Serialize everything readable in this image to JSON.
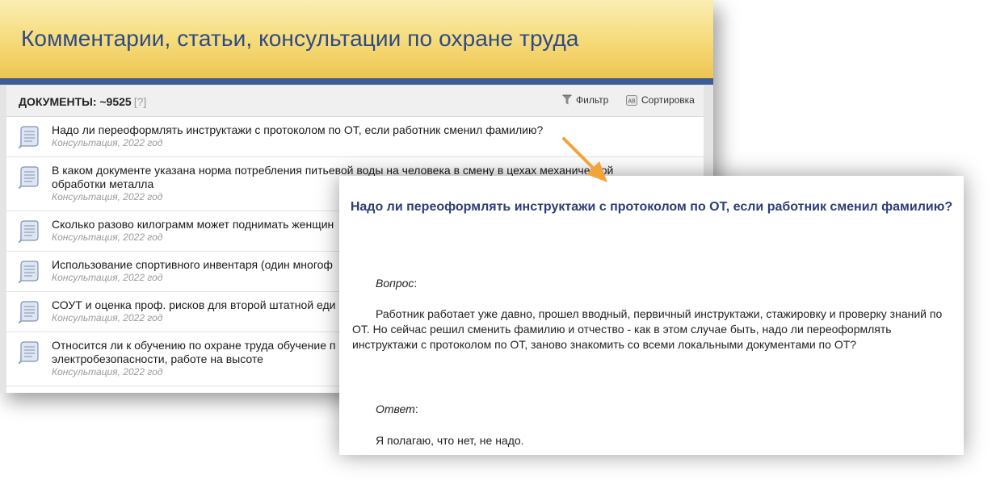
{
  "banner": {
    "title": "Комментарии, статьи, консультации по охране труда"
  },
  "documents": {
    "count_label": "ДОКУМЕНТЫ: ~9525",
    "help_label": "[?]",
    "filter_label": "Фильтр",
    "sort_label": "Сортировка",
    "items": [
      {
        "title": "Надо ли переоформлять инструктажи с протоколом по ОТ, если работник сменил фамилию?",
        "meta": "Консультация, 2022 год"
      },
      {
        "title": "В каком документе указана норма потребления питьевой воды на человека в смену в цехах механической обработки металла",
        "meta": "Консультация, 2022 год"
      },
      {
        "title": "Сколько разово килограмм может поднимать женщин",
        "meta": "Консультация, 2022 год"
      },
      {
        "title": "Использование спортивного инвентаря (один многоф",
        "meta": "Консультация, 2022 год"
      },
      {
        "title": "СОУТ и оценка проф. рисков для второй штатной еди",
        "meta": "Консультация, 2022 год"
      },
      {
        "title": "Относится ли к обучению по охране труда обучение п электробезопасности, работе на высоте",
        "meta": "Консультация, 2022 год"
      }
    ]
  },
  "document_view": {
    "title": "Надо ли переоформлять инструктажи с протоколом по ОТ, если работник сменил фамилию?",
    "question_label": "Вопрос",
    "question_text": "Работник работает уже давно, прошел вводный, первичный инструктажи, стажировку и проверку знаний по ОТ. Но сейчас решил сменить фамилию и отчество - как в этом случае быть, надо ли переоформлять инструктажи с протоколом по ОТ, заново знакомить со всеми локальными документами по ОТ?",
    "answer_label": "Ответ",
    "answer_text": "Я полагаю, что нет, не надо."
  },
  "colors": {
    "banner_title": "#2e4a86",
    "banner_bar": "#3e5c94",
    "document_title": "#2b3e75",
    "arrow": "#f2a33a"
  },
  "icons": {
    "filter": "funnel-icon",
    "sort": "sort-icon",
    "document": "document-scroll-icon",
    "pointer": "arrow-icon"
  }
}
